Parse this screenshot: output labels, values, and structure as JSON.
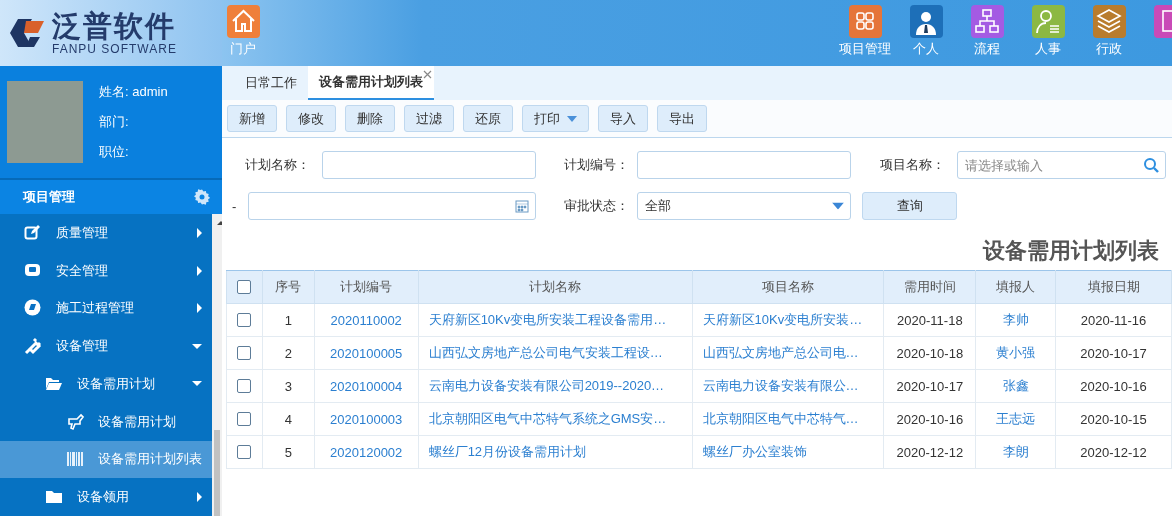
{
  "logo": {
    "name": "泛普软件",
    "subtitle": "FANPU SOFTWARE"
  },
  "user": {
    "fields": [
      "姓名: admin",
      "部门:",
      "职位:"
    ]
  },
  "topbar": {
    "home": {
      "label": "门户"
    },
    "modules": [
      {
        "label": "项目管理",
        "color": "#e5753a"
      },
      {
        "label": "个人",
        "color": "#1d6fb8"
      },
      {
        "label": "流程",
        "color": "#a45be3"
      },
      {
        "label": "人事",
        "color": "#8cb843"
      },
      {
        "label": "行政",
        "color": "#b97c2d"
      },
      {
        "color": "#c94ab7"
      }
    ]
  },
  "sidebar": {
    "header": "项目管理",
    "items": [
      {
        "label": "质量管理",
        "expanded": false
      },
      {
        "label": "安全管理",
        "expanded": false
      },
      {
        "label": "施工过程管理",
        "expanded": false
      },
      {
        "label": "设备管理",
        "expanded": true,
        "children": [
          {
            "label": "设备需用计划",
            "expanded": true,
            "children": [
              {
                "label": "设备需用计划",
                "selected": false
              },
              {
                "label": "设备需用计划列表",
                "selected": true
              }
            ]
          },
          {
            "label": "设备领用",
            "expanded": false
          }
        ]
      }
    ]
  },
  "tabs": [
    {
      "label": "日常工作",
      "selected": false
    },
    {
      "label": "设备需用计划列表",
      "selected": true
    }
  ],
  "toolbar": [
    {
      "label": "新增",
      "kind": "button"
    },
    {
      "label": "修改",
      "kind": "button"
    },
    {
      "label": "删除",
      "kind": "button"
    },
    {
      "label": "过滤",
      "kind": "button"
    },
    {
      "label": "还原",
      "kind": "button"
    },
    {
      "label": "打印",
      "kind": "dropdown"
    },
    {
      "label": "导入",
      "kind": "button"
    },
    {
      "label": "导出",
      "kind": "button"
    }
  ],
  "filters": [
    {
      "label": "计划名称：",
      "kind": "text"
    },
    {
      "label": "计划编号：",
      "kind": "text"
    },
    {
      "label": "项目名称：",
      "kind": "search",
      "placeholder": "请选择或输入"
    },
    {
      "label": "-",
      "kind": "date"
    },
    {
      "label": "审批状态：",
      "kind": "select",
      "value": "全部"
    }
  ],
  "query_button": "查询",
  "list_title": "设备需用计划列表",
  "table": {
    "select_all_checked": false,
    "columns": [
      {
        "label": "序号",
        "kind": "text"
      },
      {
        "label": "计划编号",
        "kind": "link"
      },
      {
        "label": "计划名称",
        "kind": "link"
      },
      {
        "label": "项目名称",
        "kind": "link"
      },
      {
        "label": "需用时间",
        "kind": "text"
      },
      {
        "label": "填报人",
        "kind": "link"
      },
      {
        "label": "填报日期",
        "kind": "text"
      }
    ],
    "rows": [
      {
        "checked": false,
        "cells": [
          "1",
          "2020110002",
          "天府新区10Kv变电所安装工程设备需用…",
          "天府新区10Kv变电所安装…",
          "2020-11-18",
          "李帅",
          "2020-11-16"
        ]
      },
      {
        "checked": false,
        "cells": [
          "2",
          "2020100005",
          "山西弘文房地产总公司电气安装工程设…",
          "山西弘文房地产总公司电…",
          "2020-10-18",
          "黄小强",
          "2020-10-17"
        ]
      },
      {
        "checked": false,
        "cells": [
          "3",
          "2020100004",
          "云南电力设备安装有限公司2019--2020…",
          "云南电力设备安装有限公…",
          "2020-10-17",
          "张鑫",
          "2020-10-16"
        ]
      },
      {
        "checked": false,
        "cells": [
          "4",
          "2020100003",
          "北京朝阳区电气中芯特气系统之GMS安…",
          "北京朝阳区电气中芯特气…",
          "2020-10-16",
          "王志远",
          "2020-10-15"
        ]
      },
      {
        "checked": false,
        "cells": [
          "5",
          "2020120002",
          "螺丝厂12月份设备需用计划",
          "螺丝厂办公室装饰",
          "2020-12-12",
          "李朗",
          "2020-12-12"
        ]
      }
    ]
  }
}
